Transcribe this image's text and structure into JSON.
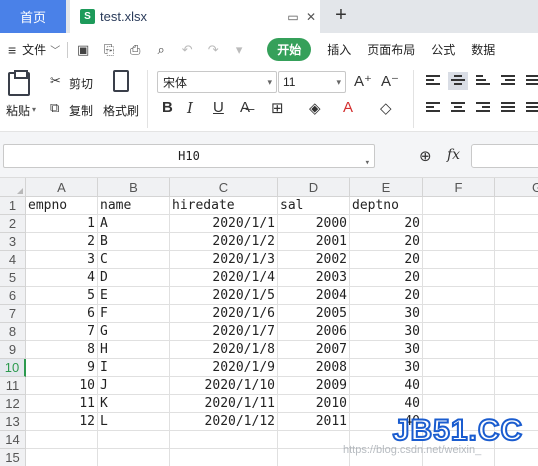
{
  "tabs": {
    "home": "首页",
    "file": "test.xlsx",
    "file_icon": "S"
  },
  "menu": {
    "file": "文件",
    "items": [
      "开始",
      "插入",
      "页面布局",
      "公式",
      "数据"
    ],
    "active_color": "#35a05a"
  },
  "ribbon": {
    "paste": "粘贴",
    "cut": "剪切",
    "copy": "复制",
    "format_painter": "格式刷",
    "font_name": "宋体",
    "font_size": "11",
    "bold": "B",
    "italic": "I",
    "underline": "U"
  },
  "formula_bar": {
    "name_box": "H10",
    "fx": "fx",
    "formula": ""
  },
  "sheet": {
    "columns": [
      "A",
      "B",
      "C",
      "D",
      "E",
      "F",
      "G"
    ],
    "row_numbers": [
      "1",
      "2",
      "3",
      "4",
      "5",
      "6",
      "7",
      "8",
      "9",
      "10",
      "11",
      "12",
      "13",
      "14",
      "15"
    ],
    "selected_row": "10",
    "header": [
      "empno",
      "name",
      "hiredate",
      "sal",
      "deptno"
    ],
    "rows": [
      [
        "1",
        "A",
        "2020/1/1",
        "2000",
        "20"
      ],
      [
        "2",
        "B",
        "2020/1/2",
        "2001",
        "20"
      ],
      [
        "3",
        "C",
        "2020/1/3",
        "2002",
        "20"
      ],
      [
        "4",
        "D",
        "2020/1/4",
        "2003",
        "20"
      ],
      [
        "5",
        "E",
        "2020/1/5",
        "2004",
        "20"
      ],
      [
        "6",
        "F",
        "2020/1/6",
        "2005",
        "30"
      ],
      [
        "7",
        "G",
        "2020/1/7",
        "2006",
        "30"
      ],
      [
        "8",
        "H",
        "2020/1/8",
        "2007",
        "30"
      ],
      [
        "9",
        "I",
        "2020/1/9",
        "2008",
        "30"
      ],
      [
        "10",
        "J",
        "2020/1/10",
        "2009",
        "40"
      ],
      [
        "11",
        "K",
        "2020/1/11",
        "2010",
        "40"
      ],
      [
        "12",
        "L",
        "2020/1/12",
        "2011",
        "40"
      ]
    ]
  },
  "watermark": "https://blog.csdn.net/weixin_",
  "brand": "JB51.CC"
}
